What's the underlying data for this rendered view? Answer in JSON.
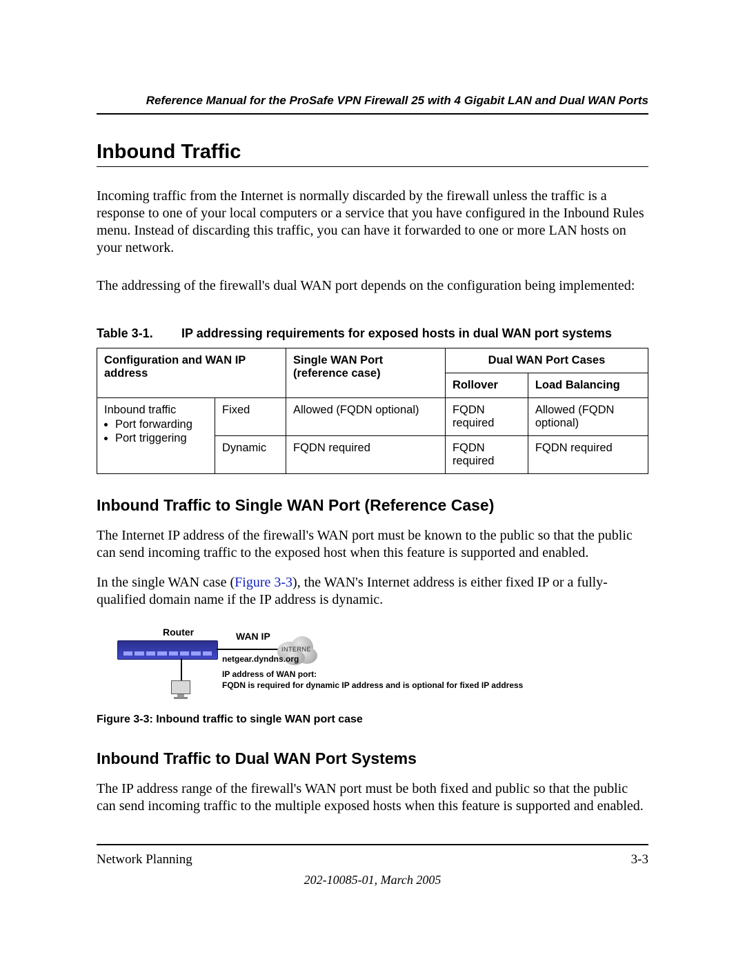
{
  "header": {
    "title": "Reference Manual for the ProSafe VPN Firewall 25 with 4 Gigabit LAN and Dual WAN Ports"
  },
  "section": {
    "heading": "Inbound Traffic",
    "para1": "Incoming traffic from the Internet is normally discarded by the firewall unless the traffic is a response to one of your local computers or a service that you have configured in the Inbound Rules menu. Instead of discarding this traffic, you can have it forwarded to one or more LAN hosts on your network.",
    "para2": "The addressing of the firewall's dual WAN port depends on the configuration being implemented:"
  },
  "table": {
    "label": "Table 3-1.",
    "caption": "IP addressing requirements for exposed hosts in dual WAN port systems",
    "head": {
      "config": "Configuration and WAN IP address",
      "single": "Single WAN Port (reference case)",
      "dual": "Dual WAN Port Cases",
      "rollover": "Rollover",
      "loadbal": "Load Balancing"
    },
    "row_label": {
      "title": "Inbound traffic",
      "b1": "Port forwarding",
      "b2": "Port triggering"
    },
    "rows": [
      {
        "mode": "Fixed",
        "single": "Allowed (FQDN optional)",
        "rollover": "FQDN required",
        "loadbal": "Allowed (FQDN optional)"
      },
      {
        "mode": "Dynamic",
        "single": "FQDN required",
        "rollover": "FQDN required",
        "loadbal": "FQDN required"
      }
    ]
  },
  "sub1": {
    "heading": "Inbound Traffic to Single WAN Port (Reference Case)",
    "para1": "The Internet IP address of the firewall's WAN port must be known to the public so that the public can send incoming traffic to the exposed host when this feature is supported and enabled.",
    "para2_pre": "In the single WAN case (",
    "figref": "Figure 3-3",
    "para2_post": "), the WAN's Internet address is either fixed IP or a fully-qualified domain name if the IP address is dynamic."
  },
  "figure": {
    "router": "Router",
    "wanip": "WAN IP",
    "internet": "INTERNE",
    "dyndns": "netgear.dyndns.org",
    "note1": "IP address of WAN port:",
    "note2": "FQDN is required for dynamic IP address and is optional for fixed IP address",
    "caption": "Figure 3-3:  Inbound traffic to single WAN port case"
  },
  "sub2": {
    "heading": "Inbound Traffic to Dual WAN Port Systems",
    "para1": "The IP address range of the firewall's WAN port must be both fixed and public so that the public can send incoming traffic to the multiple exposed hosts when this feature is supported and enabled."
  },
  "footer": {
    "left": "Network Planning",
    "right": "3-3",
    "sub": "202-10085-01, March 2005"
  }
}
